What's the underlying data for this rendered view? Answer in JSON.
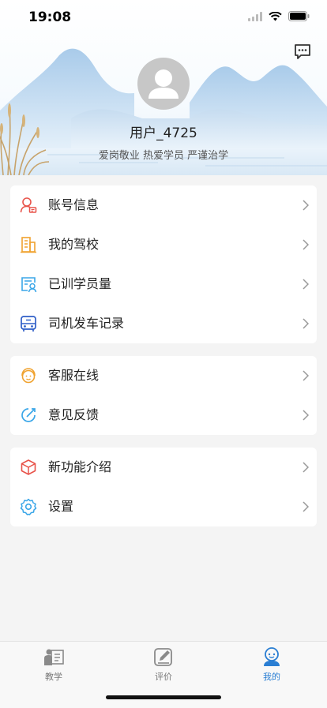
{
  "status_bar": {
    "time": "19:08"
  },
  "profile": {
    "username": "用户_4725",
    "motto": "爱岗敬业 热爱学员 严谨治学"
  },
  "menu_groups": [
    {
      "items": [
        {
          "label": "账号信息",
          "icon": "account-icon",
          "color": "#e8534a"
        },
        {
          "label": "我的驾校",
          "icon": "school-building-icon",
          "color": "#f0a22e"
        },
        {
          "label": "已训学员量",
          "icon": "students-count-icon",
          "color": "#3aa6e8"
        },
        {
          "label": "司机发车记录",
          "icon": "bus-icon",
          "color": "#2f5fc8"
        }
      ]
    },
    {
      "items": [
        {
          "label": "客服在线",
          "icon": "customer-service-icon",
          "color": "#f0a22e"
        },
        {
          "label": "意见反馈",
          "icon": "feedback-icon",
          "color": "#3aa6e8"
        }
      ]
    },
    {
      "items": [
        {
          "label": "新功能介绍",
          "icon": "cube-icon",
          "color": "#e8534a"
        },
        {
          "label": "设置",
          "icon": "gear-icon",
          "color": "#3aa6e8"
        }
      ]
    }
  ],
  "tab_bar": {
    "tabs": [
      {
        "label": "教学",
        "icon": "teaching-icon",
        "active": false
      },
      {
        "label": "评价",
        "icon": "review-icon",
        "active": false
      },
      {
        "label": "我的",
        "icon": "profile-icon",
        "active": true
      }
    ],
    "active_color": "#2a7ed3"
  }
}
